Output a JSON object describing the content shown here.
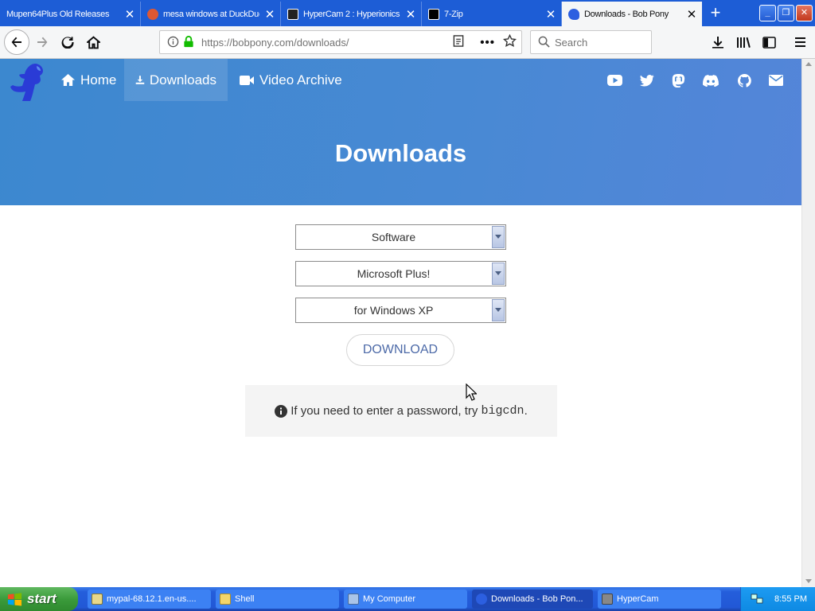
{
  "browser": {
    "tabs": [
      {
        "title": "Mupen64Plus Old Releases",
        "active": false
      },
      {
        "title": "mesa windows at DuckDuckGo",
        "active": false
      },
      {
        "title": "HyperCam 2 : Hyperionics",
        "active": false
      },
      {
        "title": "7-Zip",
        "active": false
      },
      {
        "title": "Downloads - Bob Pony",
        "active": true
      }
    ],
    "url": "https://bobpony.com/downloads/",
    "search_placeholder": "Search"
  },
  "site": {
    "nav": [
      {
        "label": "Home"
      },
      {
        "label": "Downloads"
      },
      {
        "label": "Video Archive"
      }
    ],
    "hero_title": "Downloads",
    "selects": [
      {
        "value": "Software"
      },
      {
        "value": "Microsoft Plus!"
      },
      {
        "value": "for Windows XP"
      }
    ],
    "download_label": "DOWNLOAD",
    "notice_text": "If you need to enter a password, try ",
    "notice_code": "bigcdn",
    "notice_end": "."
  },
  "taskbar": {
    "start_label": "start",
    "tasks": [
      {
        "label": "mypal-68.12.1.en-us...."
      },
      {
        "label": "Shell"
      },
      {
        "label": "My Computer"
      },
      {
        "label": "Downloads - Bob Pon..."
      },
      {
        "label": "HyperCam"
      }
    ],
    "clock": "8:55 PM"
  },
  "colors": {
    "hero": "#4989d4",
    "link": "#4d6aa8"
  }
}
